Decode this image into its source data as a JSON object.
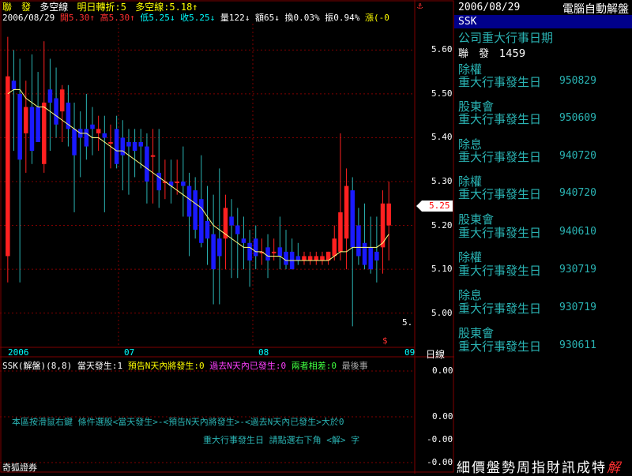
{
  "colors": {
    "up": "#ff2020",
    "down": "#1a1aff",
    "ma": "#ffff80",
    "grid": "#800000",
    "cyan": "#2ab3b3",
    "price_tag_bg": "#ffffff"
  },
  "header": {
    "stock_name": "聯　發",
    "date": "2006/08/29",
    "mode": "多空線",
    "next_turn": "明日轉折:5",
    "mode_value": "多空線:5.18↑",
    "open": "開5.30↑",
    "high": "高5.30↑",
    "low": "低5.25↓",
    "close": "收5.25↓",
    "volume": "量122↓",
    "amount": "額65↓",
    "turnover": "換0.03%",
    "amplitude": "振0.94%",
    "change": "漲(-0"
  },
  "axis": {
    "price_ticks": [
      "5.60",
      "5.50",
      "5.40",
      "5.30",
      "5.20",
      "5.10",
      "5.00"
    ],
    "current_price": "5.25",
    "partial_label": "5.",
    "dollar_marker": "$",
    "top_marker": "⚓",
    "time_ticks": [
      "2006",
      "07",
      "08",
      "09"
    ],
    "period": "日線",
    "indicator_ticks": [
      "0.00",
      "0.00",
      "-0.00",
      "-0.00"
    ]
  },
  "indicator": {
    "name": "SSK(解盤)(8,8)",
    "legend_today": "當天發生:1",
    "legend_forecast": "預告N天內將發生:0",
    "legend_past": "過去N天內已發生:0",
    "legend_both": "兩者相差:0",
    "legend_last": "最後事",
    "hint1": "本區按滑鼠右鍵 條件選股<當天發生>-<預告N天內將發生>-<過去N天內已發生>大於0",
    "hint2": "重大行事發生日 請點選右下角 <解> 字"
  },
  "footer": {
    "broker": "奇狐證券"
  },
  "panel": {
    "date": "2006/08/29",
    "title": "電腦自動解盤",
    "code": "SSK",
    "heading": "公司重大行事日期",
    "stock_line": "聯　發　1459",
    "events": [
      {
        "type": "除權",
        "label": "重大行事發生日",
        "date": "950829"
      },
      {
        "type": "股東會",
        "label": "重大行事發生日",
        "date": "950609"
      },
      {
        "type": "除息",
        "label": "重大行事發生日",
        "date": "940720"
      },
      {
        "type": "除權",
        "label": "重大行事發生日",
        "date": "940720"
      },
      {
        "type": "股東會",
        "label": "重大行事發生日",
        "date": "940610"
      },
      {
        "type": "除權",
        "label": "重大行事發生日",
        "date": "930719"
      },
      {
        "type": "除息",
        "label": "重大行事發生日",
        "date": "930719"
      },
      {
        "type": "股東會",
        "label": "重大行事發生日",
        "date": "930611"
      }
    ],
    "tabs": [
      "細",
      "價",
      "盤",
      "勢",
      "周",
      "指",
      "財",
      "訊",
      "成",
      "特",
      "解"
    ]
  },
  "chart_data": {
    "type": "candlestick",
    "price_range": [
      4.94,
      5.66
    ],
    "candles": [
      {
        "o": 5.13,
        "h": 5.63,
        "l": 5.07,
        "c": 5.54
      },
      {
        "o": 5.53,
        "h": 5.6,
        "l": 5.37,
        "c": 5.51
      },
      {
        "o": 5.5,
        "h": 5.58,
        "l": 5.07,
        "c": 5.35
      },
      {
        "o": 5.41,
        "h": 5.53,
        "l": 5.32,
        "c": 5.47
      },
      {
        "o": 5.47,
        "h": 5.59,
        "l": 5.34,
        "c": 5.37
      },
      {
        "o": 5.47,
        "h": 5.55,
        "l": 5.4,
        "c": 5.39
      },
      {
        "o": 5.34,
        "h": 5.62,
        "l": 5.32,
        "c": 5.48
      },
      {
        "o": 5.51,
        "h": 5.58,
        "l": 5.37,
        "c": 5.48
      },
      {
        "o": 5.49,
        "h": 5.56,
        "l": 5.4,
        "c": 5.43
      },
      {
        "o": 5.46,
        "h": 5.52,
        "l": 5.39,
        "c": 5.51
      },
      {
        "o": 5.48,
        "h": 5.52,
        "l": 5.38,
        "c": 5.42
      },
      {
        "o": 5.42,
        "h": 5.48,
        "l": 5.23,
        "c": 5.36
      },
      {
        "o": 5.42,
        "h": 5.46,
        "l": 5.31,
        "c": 5.4
      },
      {
        "o": 5.42,
        "h": 5.5,
        "l": 5.35,
        "c": 5.38
      },
      {
        "o": 5.43,
        "h": 5.47,
        "l": 5.36,
        "c": 5.42
      },
      {
        "o": 5.41,
        "h": 5.45,
        "l": 5.37,
        "c": 5.42
      },
      {
        "o": 5.41,
        "h": 5.45,
        "l": 5.23,
        "c": 5.4
      },
      {
        "o": 5.39,
        "h": 5.43,
        "l": 5.33,
        "c": 5.39
      },
      {
        "o": 5.42,
        "h": 5.45,
        "l": 5.33,
        "c": 5.34
      },
      {
        "o": 5.4,
        "h": 5.44,
        "l": 5.28,
        "c": 5.36
      },
      {
        "o": 5.39,
        "h": 5.42,
        "l": 5.27,
        "c": 5.38
      },
      {
        "o": 5.39,
        "h": 5.42,
        "l": 5.31,
        "c": 5.37
      },
      {
        "o": 5.39,
        "h": 5.42,
        "l": 5.33,
        "c": 5.38
      },
      {
        "o": 5.38,
        "h": 5.41,
        "l": 5.25,
        "c": 5.3
      },
      {
        "o": 5.36,
        "h": 5.42,
        "l": 5.25,
        "c": 5.36
      },
      {
        "o": 5.32,
        "h": 5.42,
        "l": 5.24,
        "c": 5.28
      },
      {
        "o": 5.3,
        "h": 5.35,
        "l": 5.26,
        "c": 5.3
      },
      {
        "o": 5.3,
        "h": 5.35,
        "l": 5.25,
        "c": 5.29
      },
      {
        "o": 5.3,
        "h": 5.35,
        "l": 5.27,
        "c": 5.3
      },
      {
        "o": 5.3,
        "h": 5.38,
        "l": 5.22,
        "c": 5.29
      },
      {
        "o": 5.29,
        "h": 5.32,
        "l": 5.13,
        "c": 5.22
      },
      {
        "o": 5.28,
        "h": 5.31,
        "l": 5.17,
        "c": 5.19
      },
      {
        "o": 5.26,
        "h": 5.36,
        "l": 5.15,
        "c": 5.16
      },
      {
        "o": 5.21,
        "h": 5.29,
        "l": 5.11,
        "c": 5.17
      },
      {
        "o": 5.18,
        "h": 5.27,
        "l": 5.02,
        "c": 5.1
      },
      {
        "o": 5.17,
        "h": 5.33,
        "l": 5.02,
        "c": 5.13
      },
      {
        "o": 5.17,
        "h": 5.27,
        "l": 5.1,
        "c": 5.24
      },
      {
        "o": 5.22,
        "h": 5.26,
        "l": 5.08,
        "c": 5.2
      },
      {
        "o": 5.2,
        "h": 5.24,
        "l": 5.08,
        "c": 5.18
      },
      {
        "o": 5.17,
        "h": 5.22,
        "l": 5.1,
        "c": 5.16
      },
      {
        "o": 5.16,
        "h": 5.19,
        "l": 5.06,
        "c": 5.12
      },
      {
        "o": 5.17,
        "h": 5.2,
        "l": 5.1,
        "c": 5.13
      },
      {
        "o": 5.14,
        "h": 5.17,
        "l": 5.11,
        "c": 5.14
      },
      {
        "o": 5.15,
        "h": 5.18,
        "l": 5.08,
        "c": 5.12
      },
      {
        "o": 5.14,
        "h": 5.17,
        "l": 5.12,
        "c": 5.14
      },
      {
        "o": 5.15,
        "h": 5.22,
        "l": 5.1,
        "c": 5.13
      },
      {
        "o": 5.14,
        "h": 5.19,
        "l": 5.1,
        "c": 5.11
      },
      {
        "o": 5.14,
        "h": 5.17,
        "l": 5.1,
        "c": 5.1
      },
      {
        "o": 5.13,
        "h": 5.16,
        "l": 5.11,
        "c": 5.12
      },
      {
        "o": 5.12,
        "h": 5.14,
        "l": 5.11,
        "c": 5.13
      },
      {
        "o": 5.12,
        "h": 5.14,
        "l": 5.11,
        "c": 5.13
      },
      {
        "o": 5.12,
        "h": 5.14,
        "l": 5.11,
        "c": 5.13
      },
      {
        "o": 5.12,
        "h": 5.14,
        "l": 5.11,
        "c": 5.13
      },
      {
        "o": 5.12,
        "h": 5.14,
        "l": 5.11,
        "c": 5.14
      },
      {
        "o": 5.13,
        "h": 5.2,
        "l": 5.12,
        "c": 5.17
      },
      {
        "o": 5.14,
        "h": 5.41,
        "l": 5.12,
        "c": 5.23
      },
      {
        "o": 5.17,
        "h": 5.33,
        "l": 5.1,
        "c": 5.29
      },
      {
        "o": 5.28,
        "h": 5.31,
        "l": 4.97,
        "c": 5.15
      },
      {
        "o": 5.2,
        "h": 5.24,
        "l": 5.11,
        "c": 5.13
      },
      {
        "o": 5.16,
        "h": 5.25,
        "l": 5.1,
        "c": 5.11
      },
      {
        "o": 5.15,
        "h": 5.22,
        "l": 5.09,
        "c": 5.1
      },
      {
        "o": 5.14,
        "h": 5.22,
        "l": 5.07,
        "c": 5.12
      },
      {
        "o": 5.15,
        "h": 5.28,
        "l": 5.09,
        "c": 5.25
      },
      {
        "o": 5.2,
        "h": 5.3,
        "l": 5.12,
        "c": 5.25
      }
    ],
    "ma": [
      5.5,
      5.51,
      5.51,
      5.49,
      5.48,
      5.47,
      5.47,
      5.46,
      5.45,
      5.44,
      5.43,
      5.42,
      5.41,
      5.41,
      5.4,
      5.4,
      5.39,
      5.38,
      5.37,
      5.37,
      5.36,
      5.35,
      5.34,
      5.33,
      5.32,
      5.31,
      5.3,
      5.29,
      5.28,
      5.27,
      5.26,
      5.25,
      5.24,
      5.22,
      5.2,
      5.19,
      5.18,
      5.17,
      5.16,
      5.15,
      5.15,
      5.14,
      5.14,
      5.13,
      5.13,
      5.13,
      5.12,
      5.12,
      5.12,
      5.12,
      5.12,
      5.12,
      5.12,
      5.12,
      5.13,
      5.14,
      5.14,
      5.15,
      5.15,
      5.15,
      5.15,
      5.15,
      5.16,
      5.18
    ]
  }
}
